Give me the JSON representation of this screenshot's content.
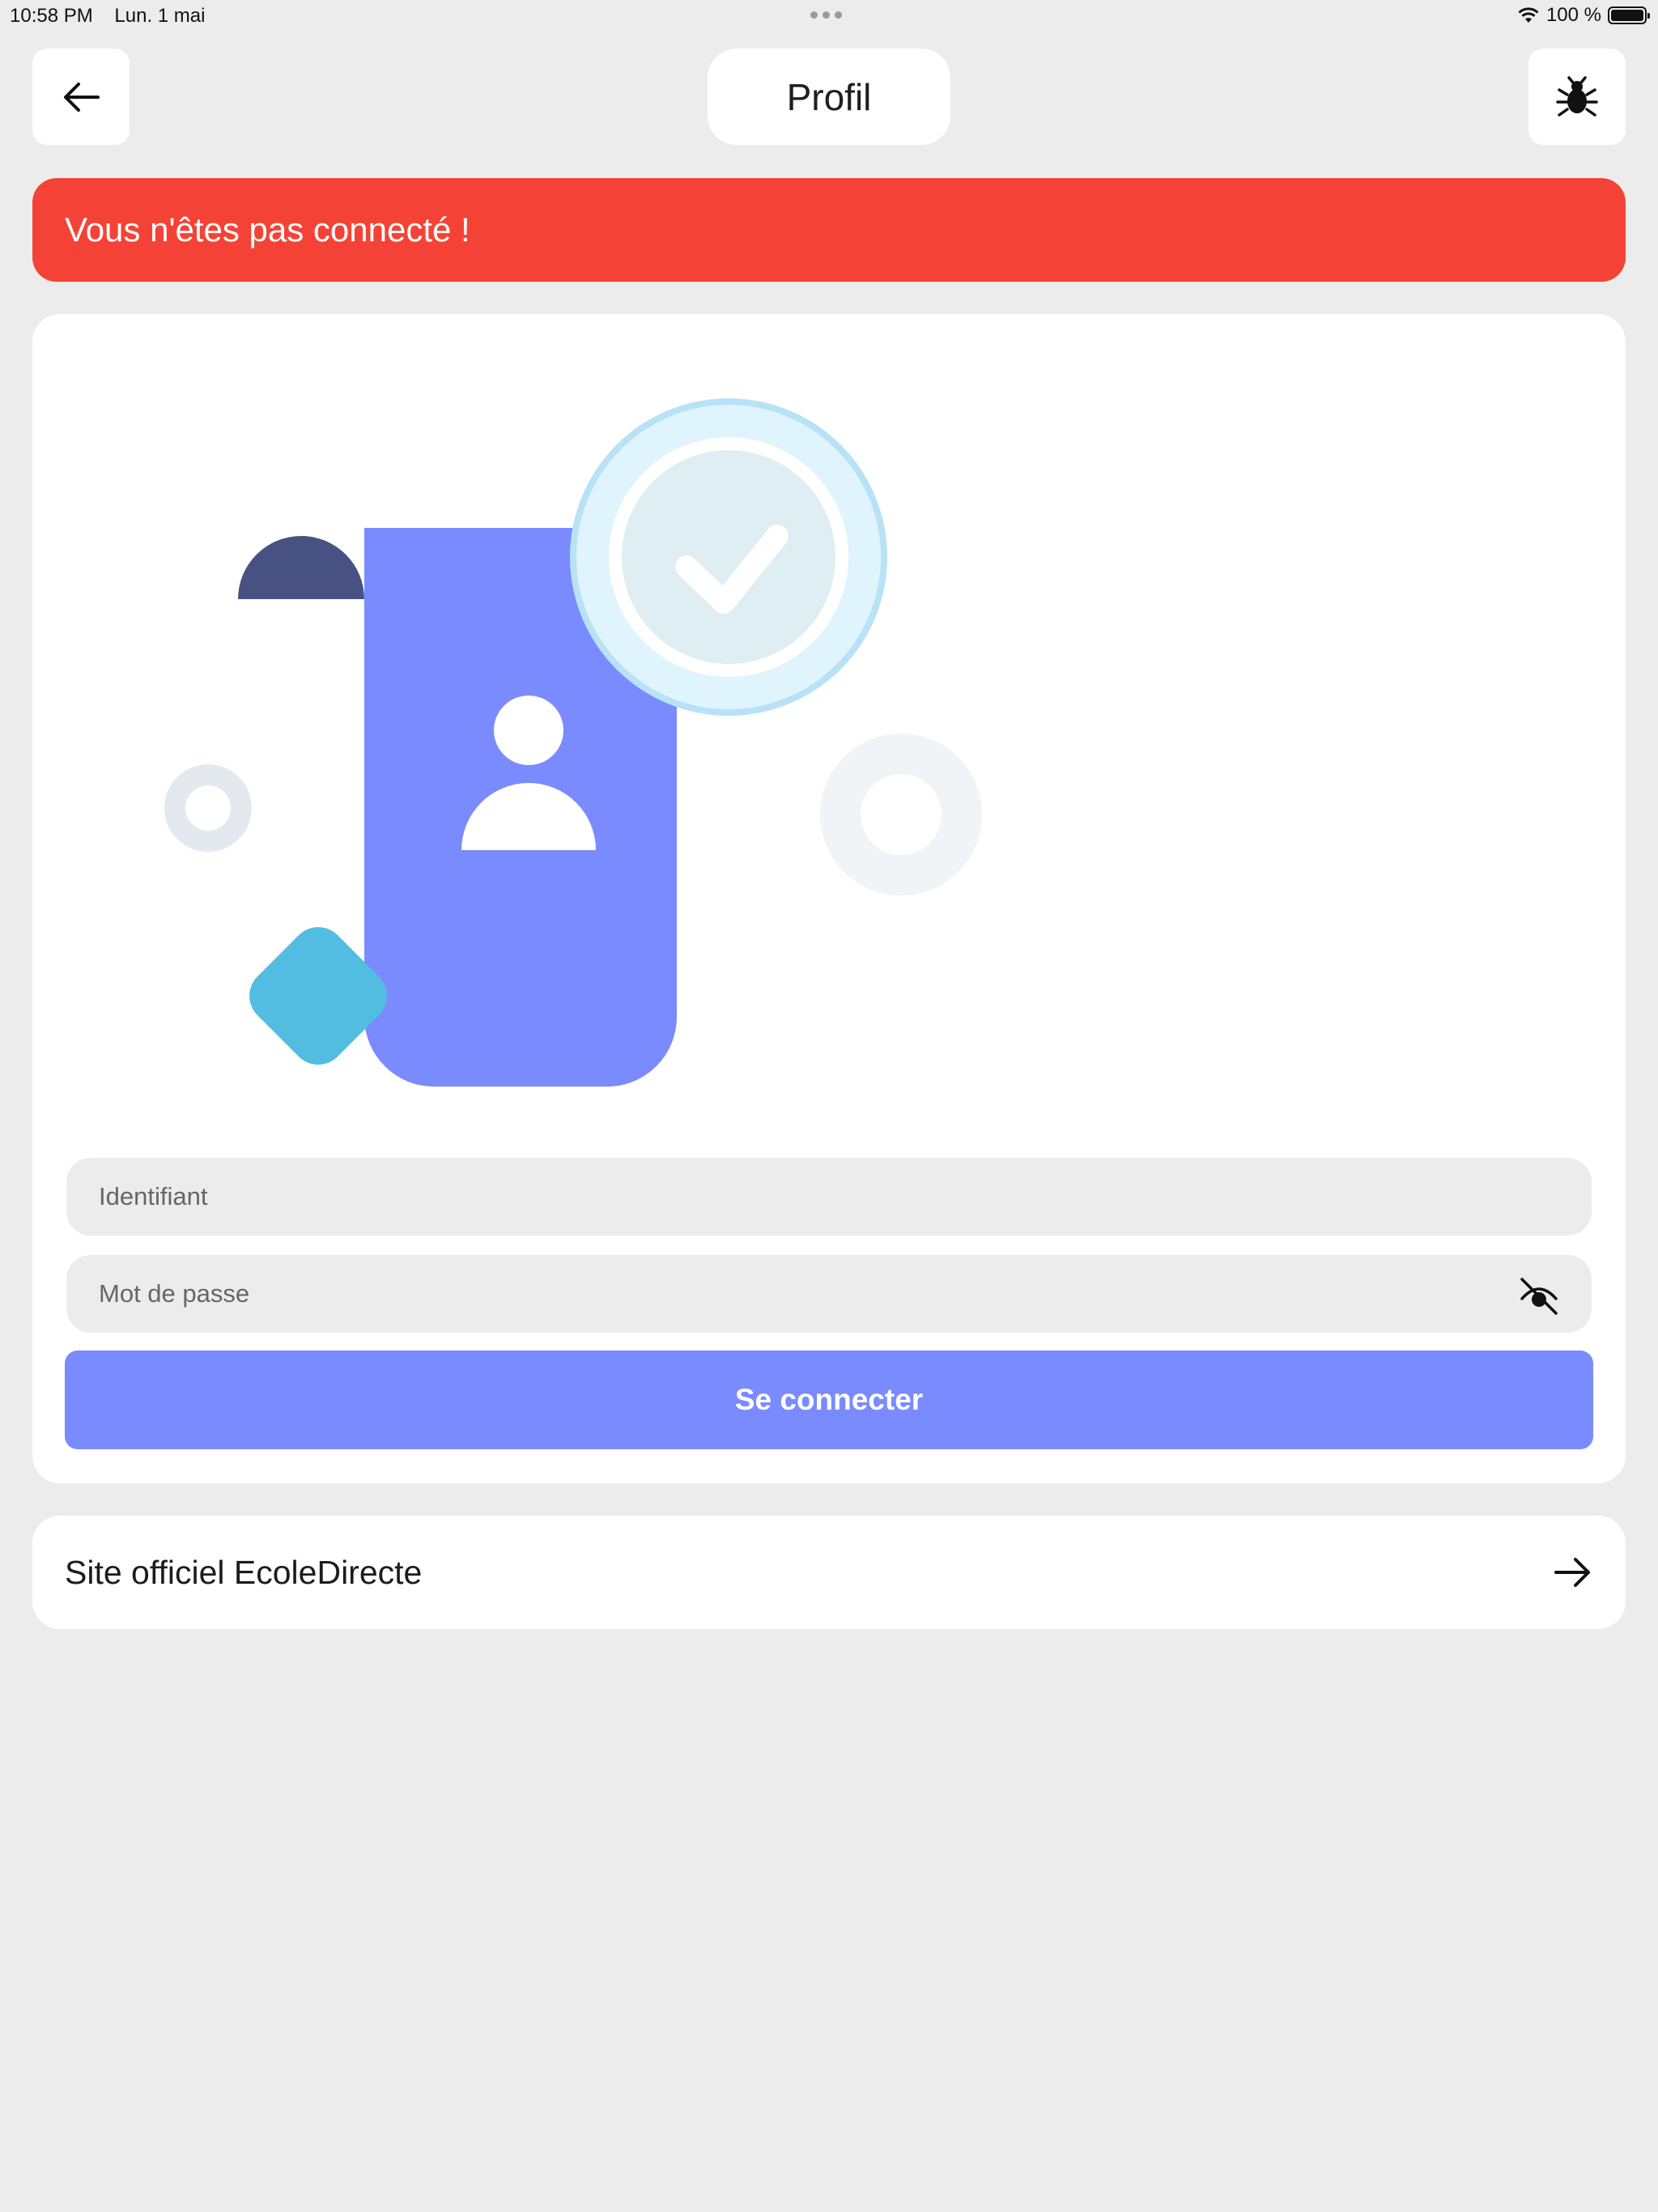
{
  "status_bar": {
    "time": "10:58 PM",
    "date": "Lun. 1 mai",
    "battery": "100 %",
    "battery_level": 1.0
  },
  "header": {
    "back_icon": "arrow-left-icon",
    "title": "Profil",
    "bug_icon": "bug-icon"
  },
  "alert": {
    "message": "Vous n'êtes pas connecté !",
    "color": "#f44336"
  },
  "login": {
    "illustration": "profile-document-check-illustration",
    "username_placeholder": "Identifiant",
    "password_placeholder": "Mot de passe",
    "password_toggle_icon": "eye-off-icon",
    "submit_label": "Se connecter",
    "accent_color": "#7a8bff"
  },
  "official_link": {
    "label": "Site officiel EcoleDirecte",
    "icon": "arrow-right-icon"
  }
}
